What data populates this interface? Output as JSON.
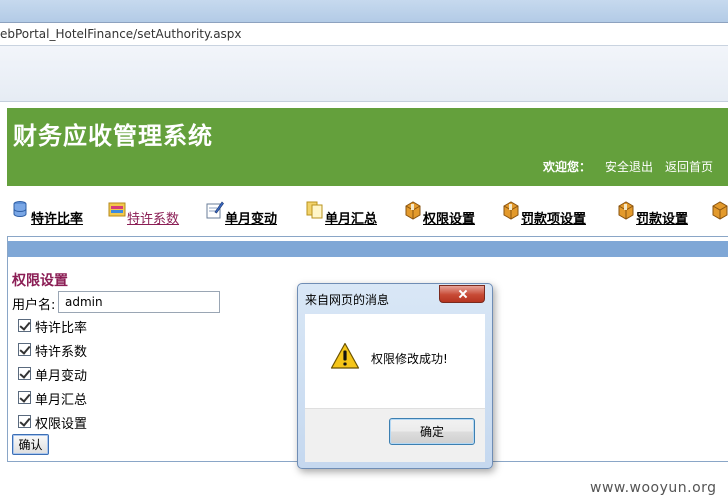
{
  "browser": {
    "address": "ebPortal_HotelFinance/setAuthority.aspx"
  },
  "header": {
    "title": "财务应收管理系统",
    "welcome": "欢迎您：",
    "logout": "安全退出",
    "home": "返回首页"
  },
  "nav": {
    "items": [
      {
        "label": "特许比率",
        "icon": "database-icon"
      },
      {
        "label": "特许系数",
        "icon": "folder-icon",
        "active": true
      },
      {
        "label": "单月变动",
        "icon": "edit-icon"
      },
      {
        "label": "单月汇总",
        "icon": "documents-icon"
      },
      {
        "label": "权限设置",
        "icon": "package-icon"
      },
      {
        "label": "罚款项设置",
        "icon": "package-icon"
      },
      {
        "label": "罚款设置",
        "icon": "package-icon"
      }
    ]
  },
  "form": {
    "section_title": "权限设置",
    "username_label": "用户名:",
    "username_value": "admin",
    "permissions": [
      {
        "label": "特许比率",
        "checked": true
      },
      {
        "label": "特许系数",
        "checked": true
      },
      {
        "label": "单月变动",
        "checked": true
      },
      {
        "label": "单月汇总",
        "checked": true
      },
      {
        "label": "权限设置",
        "checked": true
      }
    ],
    "confirm_label": "确认"
  },
  "dialog": {
    "title": "来自网页的消息",
    "message": "权限修改成功!",
    "ok_label": "确定",
    "icon": "warning-icon"
  },
  "watermark": "www.wooyun.org"
}
